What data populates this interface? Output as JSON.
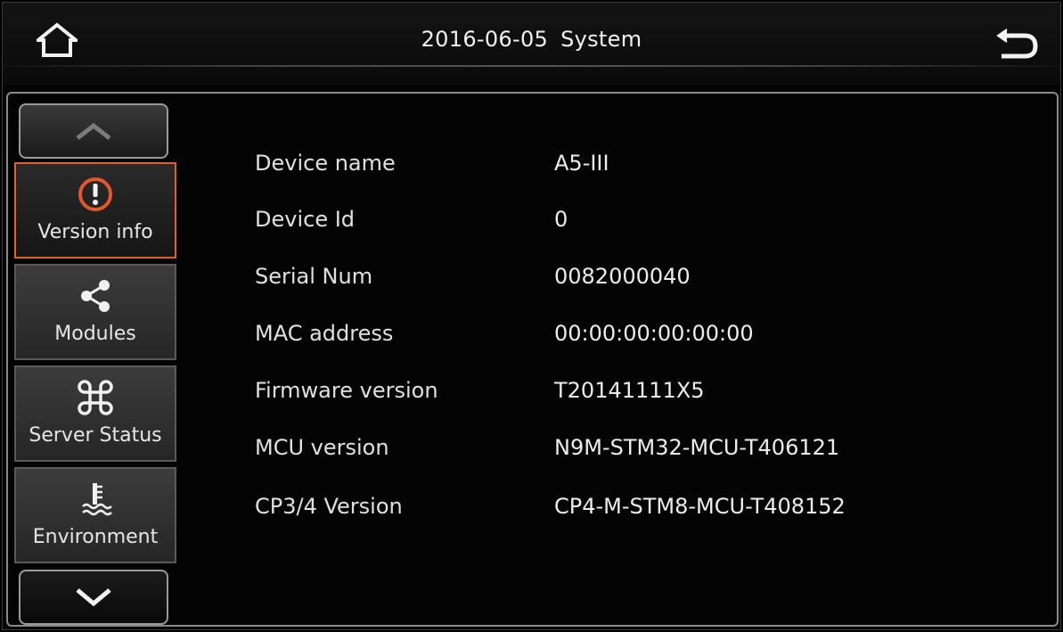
{
  "header": {
    "date": "2016-06-05",
    "title": "System",
    "home_icon": "home-icon",
    "back_icon": "back-arrow-icon"
  },
  "sidebar": {
    "up_icon": "chevron-up-icon",
    "down_icon": "chevron-down-icon",
    "items": [
      {
        "label": "Version info",
        "icon": "info-alert-icon",
        "active": true
      },
      {
        "label": "Modules",
        "icon": "share-nodes-icon",
        "active": false
      },
      {
        "label": "Server Status",
        "icon": "command-icon",
        "active": false
      },
      {
        "label": "Environment",
        "icon": "temperature-icon",
        "active": false
      }
    ]
  },
  "version_info": {
    "rows": [
      {
        "label": "Device name",
        "value": "A5-III"
      },
      {
        "label": "Device Id",
        "value": "0"
      },
      {
        "label": "Serial Num",
        "value": "0082000040"
      },
      {
        "label": "MAC address",
        "value": "00:00:00:00:00:00"
      },
      {
        "label": "Firmware version",
        "value": "T20141111X5"
      },
      {
        "label": "MCU version",
        "value": "N9M-STM32-MCU-T406121"
      },
      {
        "label": "CP3/4 Version",
        "value": "CP4-M-STM8-MCU-T408152"
      }
    ]
  },
  "colors": {
    "background": "#050505",
    "accent_active": "#e0622a",
    "info_icon": "#e4572e",
    "text": "#e8e8e8"
  }
}
